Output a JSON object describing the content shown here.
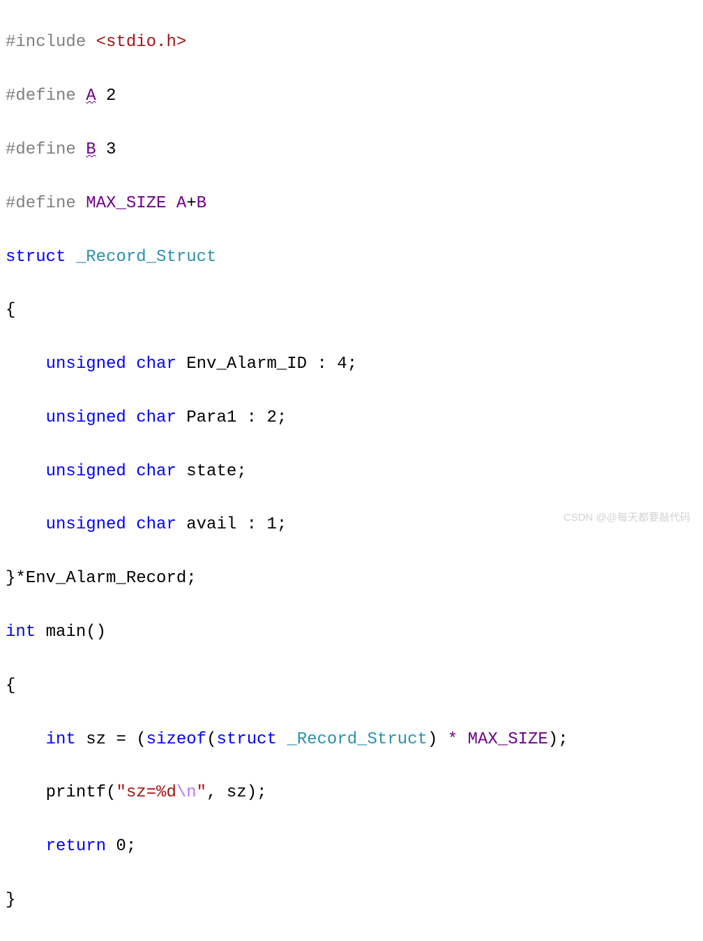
{
  "code": {
    "line1": {
      "preproc": "#include ",
      "lt": "<",
      "path": "stdio.h",
      "gt": ">"
    },
    "line2": {
      "preproc": "#define ",
      "macro": "A",
      "val": " 2"
    },
    "line3": {
      "preproc": "#define ",
      "macro": "B",
      "val": " 3"
    },
    "line4": {
      "preproc": "#define ",
      "macro": "MAX_SIZE",
      "sp": " ",
      "a": "A",
      "plus": "+",
      "b": "B"
    },
    "line5": {
      "kw": "struct",
      "sp": " ",
      "name": "_Record_Struct"
    },
    "line6": {
      "brace": "{"
    },
    "line7": {
      "indent": "    ",
      "kw1": "unsigned",
      "sp1": " ",
      "kw2": "char",
      "sp2": " ",
      "id": "Env_Alarm_ID",
      "rest": " : 4;"
    },
    "line8": {
      "indent": "    ",
      "kw1": "unsigned",
      "sp1": " ",
      "kw2": "char",
      "sp2": " ",
      "id": "Para1",
      "rest": " : 2;"
    },
    "line9": {
      "indent": "    ",
      "kw1": "unsigned",
      "sp1": " ",
      "kw2": "char",
      "sp2": " ",
      "id": "state",
      "rest": ";"
    },
    "line10": {
      "indent": "    ",
      "kw1": "unsigned",
      "sp1": " ",
      "kw2": "char",
      "sp2": " ",
      "id": "avail",
      "rest": " : 1;"
    },
    "line11": {
      "brace": "}",
      "star": "*",
      "id": "Env_Alarm_Record",
      "semi": ";"
    },
    "line12": {
      "kw": "int",
      "sp": " ",
      "fn": "main",
      "paren": "()"
    },
    "line13": {
      "brace": "{"
    },
    "line14": {
      "indent": "    ",
      "kw": "int",
      "sp": " ",
      "id": "sz",
      "eq": " = (",
      "szof": "sizeof",
      "po": "(",
      "st": "struct",
      "sp2": " ",
      "tn": "_Record_Struct",
      "pc": ")",
      "mul": " * ",
      "macro": "MAX_SIZE",
      "end": ");"
    },
    "line15": {
      "indent": "    ",
      "fn": "printf",
      "po": "(",
      "q1": "\"",
      "str": "sz=%d",
      "esc": "\\n",
      "q2": "\"",
      "rest": ", sz);"
    },
    "line16": {
      "indent": "    ",
      "kw": "return",
      "val": " 0;"
    },
    "line17": {
      "brace": "}"
    }
  },
  "watermark": "CSDN @@每天都要敲代码"
}
